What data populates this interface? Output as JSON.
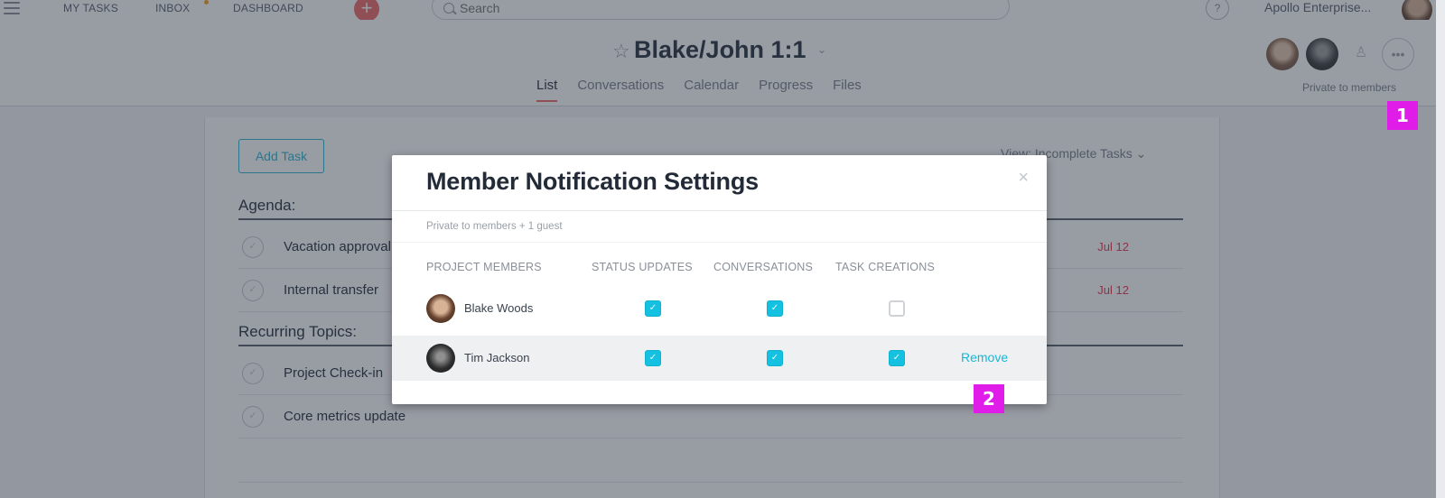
{
  "topbar": {
    "nav": [
      "MY TASKS",
      "INBOX",
      "DASHBOARD"
    ],
    "inbox_has_notification": true,
    "add_icon": "plus-icon",
    "search": {
      "placeholder": "Search",
      "value": ""
    },
    "help_icon": "help-icon",
    "org_name": "Apollo Enterprise...",
    "user_avatar": "user-avatar"
  },
  "project": {
    "title": "Blake/John 1:1",
    "star_icon": "☆",
    "chevron": "⌄",
    "tabs": [
      {
        "label": "List",
        "active": true
      },
      {
        "label": "Conversations",
        "active": false
      },
      {
        "label": "Calendar",
        "active": false
      },
      {
        "label": "Progress",
        "active": false
      },
      {
        "label": "Files",
        "active": false
      }
    ],
    "members": [
      "avatar-1",
      "avatar-2"
    ],
    "add_member_icon": "♙",
    "more_icon": "•••",
    "privacy": "Private to members"
  },
  "list": {
    "add_task_label": "Add Task",
    "view_filter": "View: Incomplete Tasks ⌄",
    "sections": [
      {
        "name": "Agenda:",
        "tasks": [
          {
            "name": "Vacation approval",
            "due": "Jul 12"
          },
          {
            "name": "Internal transfer",
            "due": "Jul 12"
          }
        ]
      },
      {
        "name": "Recurring Topics:",
        "tasks": [
          {
            "name": "Project Check-in",
            "due": ""
          },
          {
            "name": "Core metrics update",
            "due": ""
          }
        ]
      }
    ],
    "check_glyph": "✓"
  },
  "modal": {
    "title": "Member Notification Settings",
    "close_glyph": "×",
    "subtitle": "Private to members + 1 guest",
    "columns": [
      "PROJECT MEMBERS",
      "STATUS UPDATES",
      "CONVERSATIONS",
      "TASK CREATIONS"
    ],
    "members": [
      {
        "name": "Blake Woods",
        "status_updates": true,
        "conversations": true,
        "task_creations": false,
        "remove_label": ""
      },
      {
        "name": "Tim Jackson",
        "status_updates": true,
        "conversations": true,
        "task_creations": true,
        "remove_label": "Remove"
      }
    ],
    "check_glyph": "✓"
  },
  "annotations": [
    {
      "label": "1",
      "color": "#e01ce8"
    },
    {
      "label": "2",
      "color": "#e01ce8"
    }
  ],
  "colors": {
    "accent": "#14c1e0",
    "danger": "#e8384f",
    "brand_plus": "#f06a6a",
    "marker": "#e01ce8"
  }
}
